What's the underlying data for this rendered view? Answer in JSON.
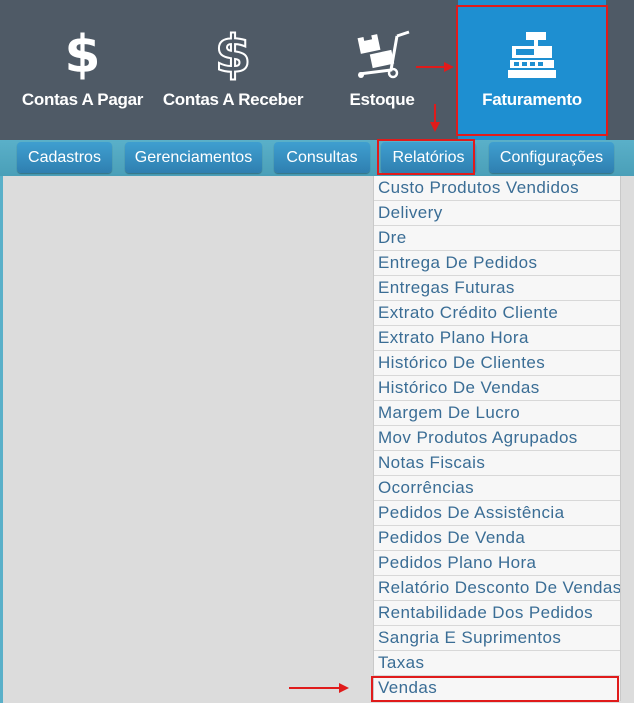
{
  "modules": [
    {
      "label": "Contas A Pagar",
      "icon": "dollar-icon"
    },
    {
      "label": "Contas A Receber",
      "icon": "dollar-outline-icon"
    },
    {
      "label": "Estoque",
      "icon": "hand-truck-icon"
    },
    {
      "label": "Faturamento",
      "icon": "cash-register-icon"
    }
  ],
  "nav": [
    "Cadastros",
    "Gerenciamentos",
    "Consultas",
    "Relatórios",
    "Configurações"
  ],
  "menu": [
    "Custo Produtos Vendidos",
    "Delivery",
    "Dre",
    "Entrega De Pedidos",
    "Entregas Futuras",
    "Extrato Crédito Cliente",
    "Extrato Plano Hora",
    "Histórico De Clientes",
    "Histórico De Vendas",
    "Margem De Lucro",
    "Mov Produtos Agrupados",
    "Notas Fiscais",
    "Ocorrências",
    "Pedidos De Assistência",
    "Pedidos De Venda",
    "Pedidos Plano Hora",
    "Relatório Desconto De Vendas",
    "Rentabilidade Dos Pedidos",
    "Sangria E Suprimentos",
    "Taxas",
    "Vendas"
  ],
  "colors": {
    "accent": "#1e8fd1",
    "annotation": "#e01b1b",
    "topbar": "#4f5a66"
  }
}
